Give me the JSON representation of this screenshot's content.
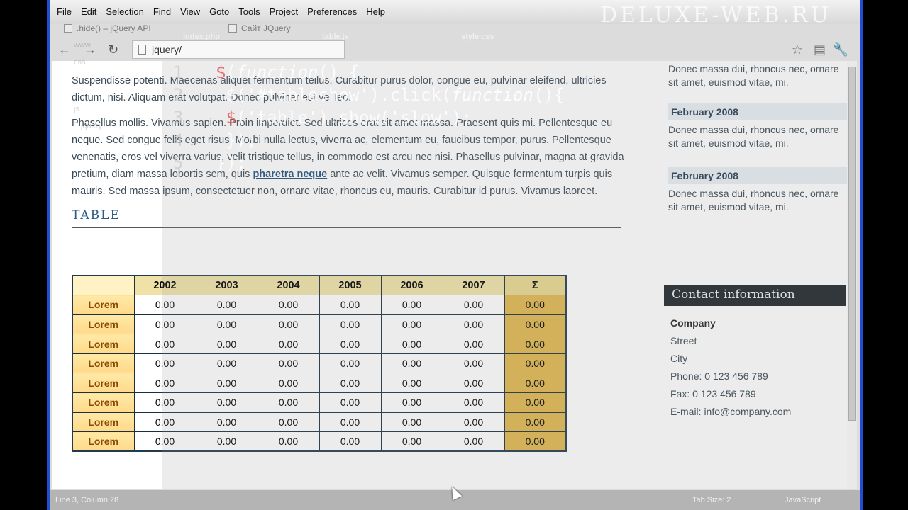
{
  "menu": [
    "File",
    "Edit",
    "Selection",
    "Find",
    "View",
    "Goto",
    "Tools",
    "Project",
    "Preferences",
    "Help"
  ],
  "brand": "DELUXE-WEB.RU",
  "browser_tabs": [
    ".hide() – jQuery API",
    "Сайт JQuery"
  ],
  "editor_tabs": [
    "index.php",
    "table.js",
    "style.css"
  ],
  "address": "jquery/",
  "sidebar_ghost": [
    "www",
    "css",
    "js",
    "jquery"
  ],
  "code_lines": [
    {
      "n": "1",
      "pre": "$",
      "kw": "function",
      "post": "() {"
    },
    {
      "n": "2",
      "pre": "  $('#tableshow').click(",
      "kw": "function",
      "post": "(){"
    },
    {
      "n": "3",
      "pre": "    $",
      "kw": "",
      "post": "('table').show('slow');"
    },
    {
      "n": "4",
      "pre": "  });",
      "kw": "",
      "post": ""
    },
    {
      "n": "5",
      "pre": "});",
      "kw": "",
      "post": ""
    }
  ],
  "content": {
    "para1": "Suspendisse potenti. Maecenas aliquet fermentum tellus. Curabitur purus dolor, congue eu, pulvinar eleifend, ultricies dictum, nisi. Aliquam erat volutpat. Donec pulvinar est vel leo.",
    "para2_pre": "Phasellus mollis. Vivamus sapien. Proin imperdiet. Sed ultrices erat sit amet massa. Praesent quis mi. Pellentesque eu neque. Sed congue felis eget risus. Morbi nulla lectus, viverra ac, elementum eu, faucibus tempor, purus. Pellentesque venenatis, eros vel viverra varius, velit tristique tellus, in commodo est arcu nec nisi. Phasellus pulvinar, magna at gravida pretium, diam massa lobortis sem, quis ",
    "para2_link": "pharetra neque",
    "para2_post": " ante ac velit. Vivamus semper. Quisque fermentum turpis quis mauris. Sed massa ipsum, consectetuer non, ornare vitae, rhoncus eu, mauris. Curabitur id purus. Vivamus laoreet.",
    "section_title": "TABLE"
  },
  "table": {
    "headers": [
      "",
      "2002",
      "2003",
      "2004",
      "2005",
      "2006",
      "2007",
      "Σ"
    ],
    "rows": [
      [
        "Lorem",
        "0.00",
        "0.00",
        "0.00",
        "0.00",
        "0.00",
        "0.00",
        "0.00"
      ],
      [
        "Lorem",
        "0.00",
        "0.00",
        "0.00",
        "0.00",
        "0.00",
        "0.00",
        "0.00"
      ],
      [
        "Lorem",
        "0.00",
        "0.00",
        "0.00",
        "0.00",
        "0.00",
        "0.00",
        "0.00"
      ],
      [
        "Lorem",
        "0.00",
        "0.00",
        "0.00",
        "0.00",
        "0.00",
        "0.00",
        "0.00"
      ],
      [
        "Lorem",
        "0.00",
        "0.00",
        "0.00",
        "0.00",
        "0.00",
        "0.00",
        "0.00"
      ],
      [
        "Lorem",
        "0.00",
        "0.00",
        "0.00",
        "0.00",
        "0.00",
        "0.00",
        "0.00"
      ],
      [
        "Lorem",
        "0.00",
        "0.00",
        "0.00",
        "0.00",
        "0.00",
        "0.00",
        "0.00"
      ],
      [
        "Lorem",
        "0.00",
        "0.00",
        "0.00",
        "0.00",
        "0.00",
        "0.00",
        "0.00"
      ]
    ]
  },
  "news": {
    "text_top": "Donec massa dui, rhoncus nec, ornare sit amet, euismod vitae, mi.",
    "items": [
      {
        "date": "February 2008",
        "text": "Donec massa dui, rhoncus nec, ornare sit amet, euismod vitae, mi."
      },
      {
        "date": "February 2008",
        "text": "Donec massa dui, rhoncus nec, ornare sit amet, euismod vitae, mi."
      }
    ]
  },
  "contact": {
    "heading": "Contact information",
    "company": "Company",
    "street": "Street",
    "city": "City",
    "phone": "Phone: 0 123 456 789",
    "fax": "Fax: 0 123 456 789",
    "email": "E-mail: info@company.com"
  },
  "status": {
    "position": "Line 3, Column 28",
    "tab_size": "Tab Size: 2",
    "syntax": "JavaScript"
  }
}
